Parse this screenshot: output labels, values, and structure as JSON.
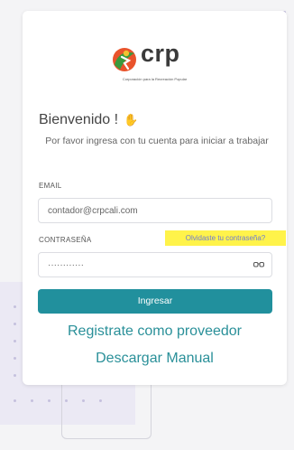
{
  "brand": {
    "name": "crp",
    "tagline": "Corporación para la Recreación Popular"
  },
  "login": {
    "greeting": "Bienvenido !",
    "greeting_icon": "waving-hand-icon",
    "subtitle": "Por favor ingresa con tu cuenta para iniciar a trabajar",
    "email_label": "EMAIL",
    "email_value": "contador@crpcali.com",
    "password_label": "CONTRASEÑA",
    "forgot_link": "Olvidaste tu contraseña?",
    "password_mask": "············",
    "submit_label": "Ingresar",
    "register_link": "Registrate como proveedor",
    "manual_link": "Descargar Manual"
  },
  "colors": {
    "accent": "#21909d",
    "link": "#2a9099",
    "highlight": "#fff34a",
    "forgot_link": "#6e7bd1"
  }
}
